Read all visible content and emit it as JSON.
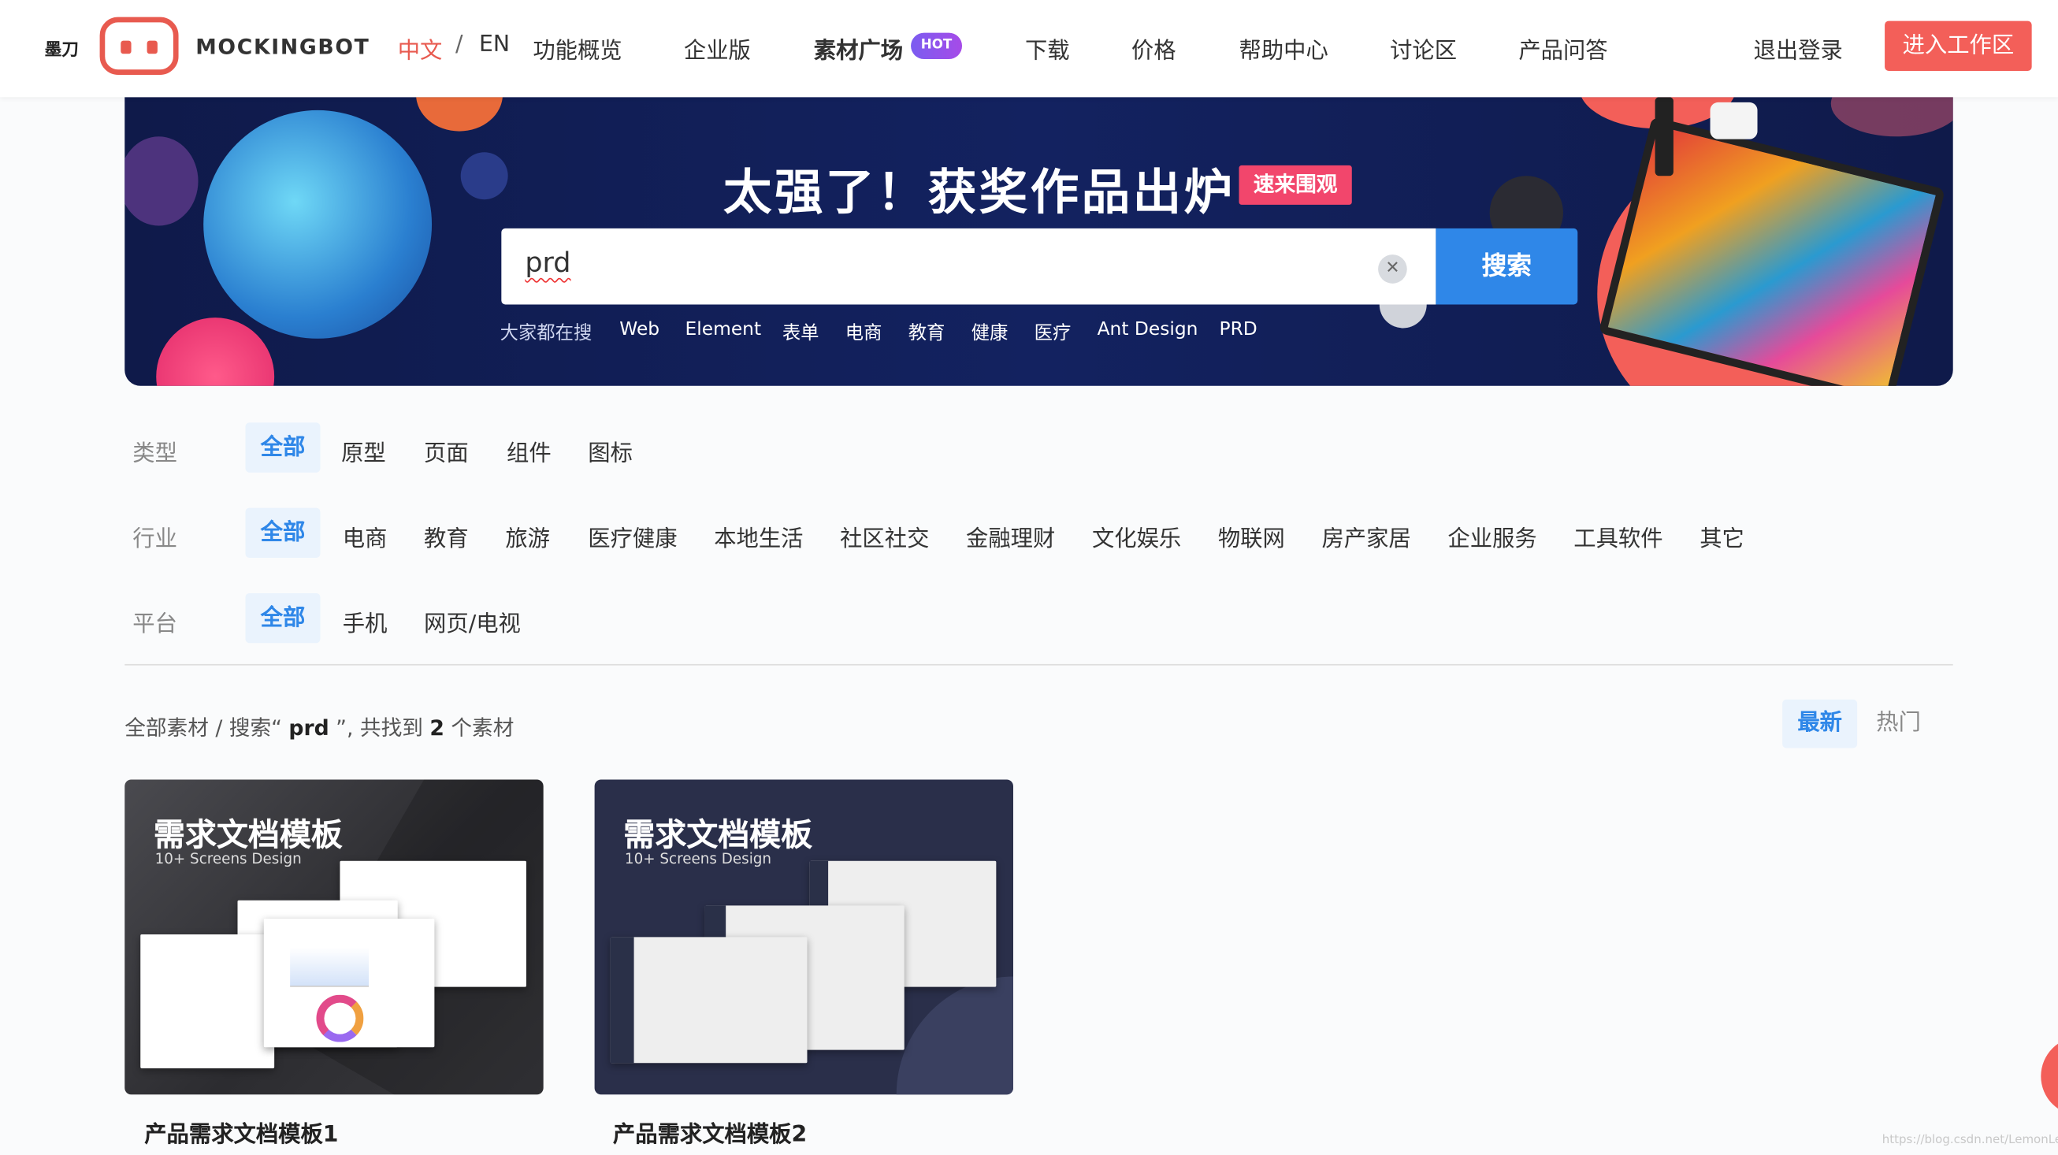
{
  "header": {
    "logo_cn": "墨刀",
    "logo_en": "MOCKINGBOT",
    "lang_zh": "中文",
    "lang_sep": "/",
    "lang_en": "EN",
    "nav": [
      "功能概览",
      "企业版",
      "素材广场",
      "下载",
      "价格",
      "帮助中心",
      "讨论区",
      "产品问答"
    ],
    "hot_badge": "HOT",
    "logout": "退出登录",
    "enter_workspace": "进入工作区",
    "accent": "#f35f59"
  },
  "banner": {
    "title": "太强了！获奖作品出炉",
    "tag": "速来围观",
    "search_value": "prd",
    "search_button": "搜索",
    "hot_label": "大家都在搜",
    "hot_terms": [
      "Web",
      "Element",
      "表单",
      "电商",
      "教育",
      "健康",
      "医疗",
      "Ant Design",
      "PRD"
    ]
  },
  "filters": {
    "type": {
      "label": "类型",
      "options": [
        "全部",
        "原型",
        "页面",
        "组件",
        "图标"
      ],
      "selected": "全部"
    },
    "industry": {
      "label": "行业",
      "options": [
        "全部",
        "电商",
        "教育",
        "旅游",
        "医疗健康",
        "本地生活",
        "社区社交",
        "金融理财",
        "文化娱乐",
        "物联网",
        "房产家居",
        "企业服务",
        "工具软件",
        "其它"
      ],
      "selected": "全部"
    },
    "platform": {
      "label": "平台",
      "options": [
        "全部",
        "手机",
        "网页/电视"
      ],
      "selected": "全部"
    }
  },
  "results": {
    "prefix": "全部素材 / 搜索“ ",
    "query": "prd",
    "middle": " ”, 共找到 ",
    "count": "2",
    "suffix": " 个素材",
    "sort_latest": "最新",
    "sort_hot": "热门"
  },
  "cards": [
    {
      "cover_title": "需求文档模板",
      "cover_subtitle": "10+ Screens Design",
      "name": "产品需求文档模板1"
    },
    {
      "cover_title": "需求文档模板",
      "cover_subtitle": "10+ Screens Design",
      "name": "产品需求文档模板2"
    }
  ],
  "watermark": "https://blog.csdn.net/LemonLe"
}
